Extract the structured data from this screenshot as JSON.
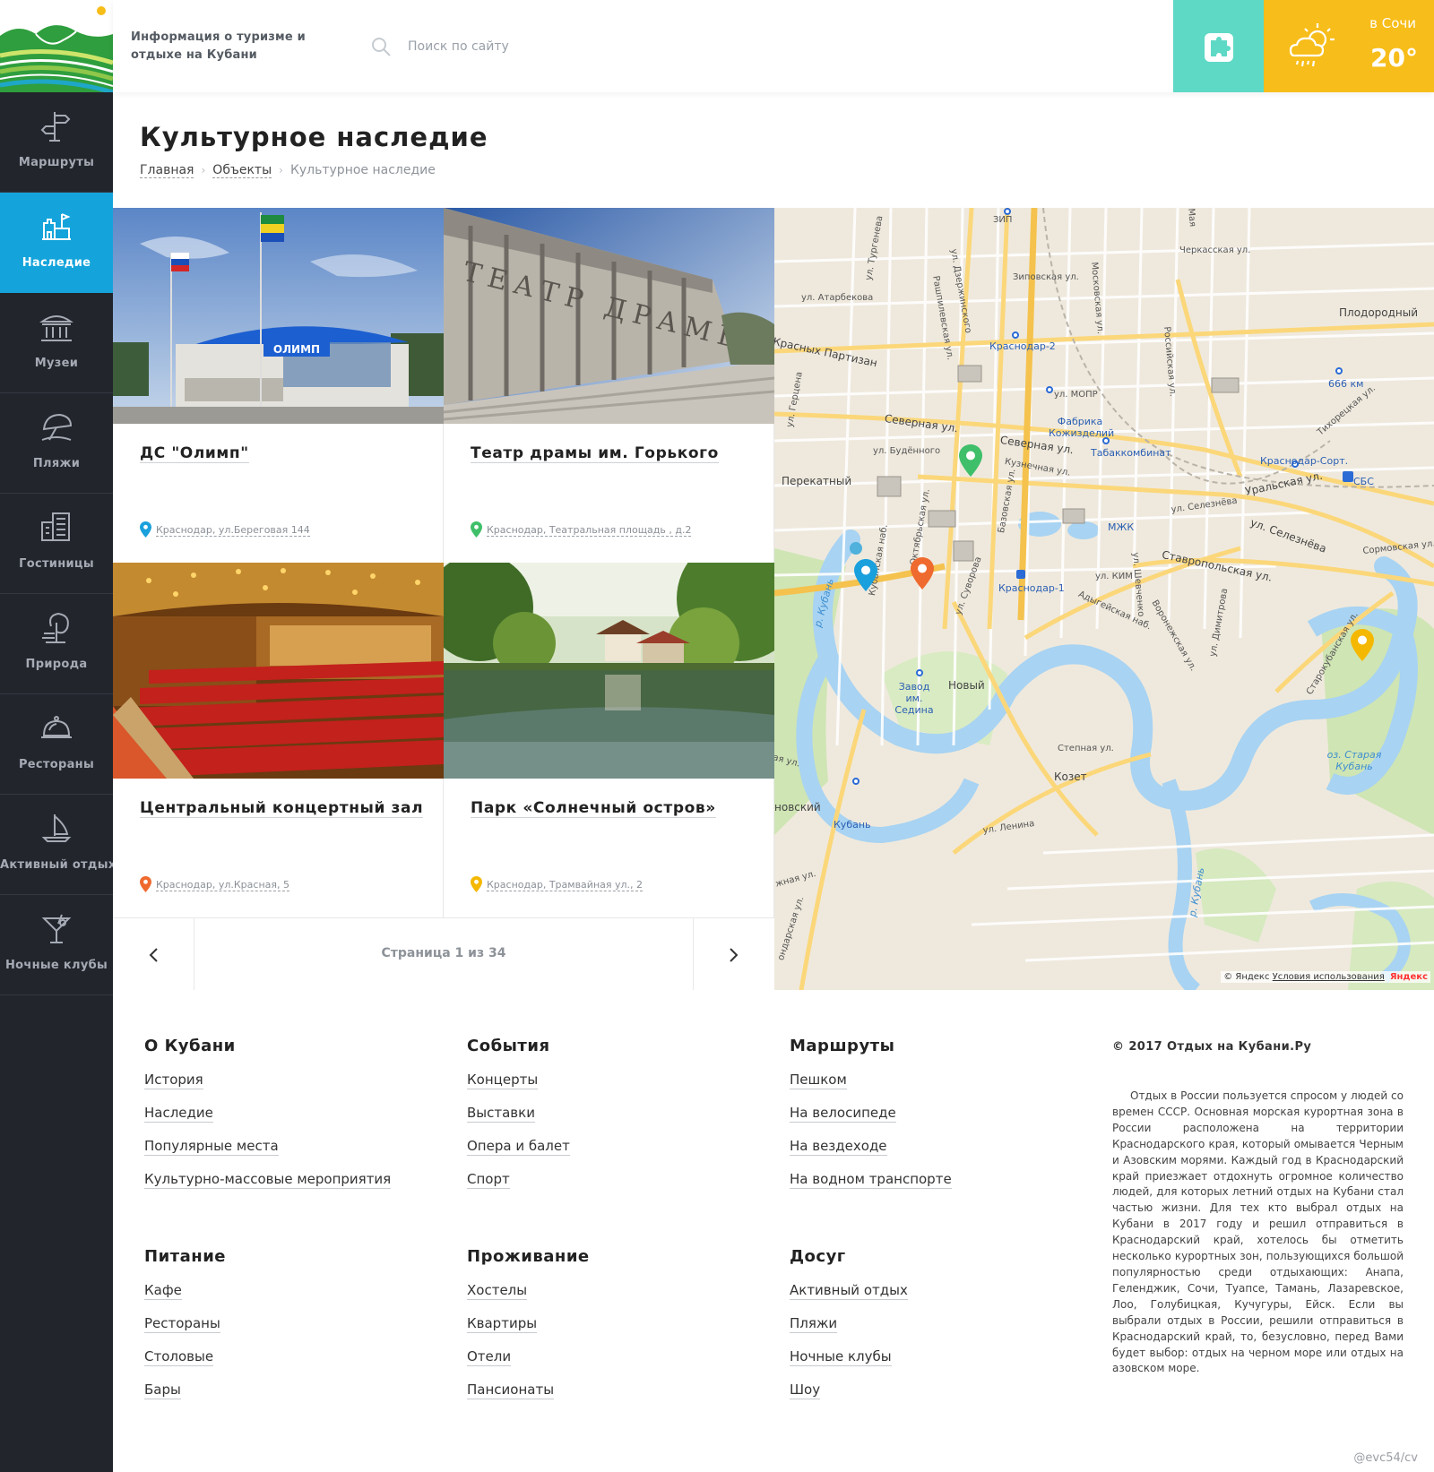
{
  "header": {
    "tagline": "Информация о туризме и отдыхе на Кубани",
    "search_placeholder": "Поиск по сайту",
    "puzzle_icon": "puzzle-icon",
    "weather": {
      "city": "в Сочи",
      "temp": "20°",
      "icon": "cloud-sun-rain-icon"
    }
  },
  "colors": {
    "sidebar_bg": "#22252c",
    "accent_blue": "#14a4db",
    "teal": "#5ed9c6",
    "yellow": "#f7bd1a",
    "pin_blue": "#1aa0dc",
    "pin_green": "#3fbf6a",
    "pin_orange": "#ef6a2e",
    "pin_yellow": "#f5b800"
  },
  "sidebar": {
    "items": [
      {
        "label": "Маршруты",
        "icon": "signpost-icon"
      },
      {
        "label": "Наследие",
        "icon": "castle-icon",
        "active": true
      },
      {
        "label": "Музеи",
        "icon": "museum-icon"
      },
      {
        "label": "Пляжи",
        "icon": "umbrella-icon"
      },
      {
        "label": "Гостиницы",
        "icon": "hotel-icon"
      },
      {
        "label": "Природа",
        "icon": "tree-icon"
      },
      {
        "label": "Рестораны",
        "icon": "cloche-icon"
      },
      {
        "label": "Активный отдых",
        "icon": "sailboat-icon"
      },
      {
        "label": "Ночные клубы",
        "icon": "cocktail-icon"
      }
    ]
  },
  "page": {
    "title": "Культурное наследие",
    "breadcrumb": [
      "Главная",
      "Объекты",
      "Культурное наследие"
    ]
  },
  "cards": [
    {
      "title": "ДС \"Олимп\"",
      "address": "Краснодар, ул.Береговая 144",
      "pin_color": "blue",
      "photo_text": "ОЛИМП"
    },
    {
      "title": "Театр драмы им. Горького",
      "address": "Краснодар, Театральная площадь , д.2",
      "pin_color": "green",
      "photo_text": "ТЕАТР ДРАМЫ"
    },
    {
      "title": "Центральный концертный зал",
      "address": "Краснодар, ул.Красная, 5",
      "pin_color": "orange"
    },
    {
      "title": "Парк «Солнечный остров»",
      "address": "Краснодар, Трамвайная ул., 2",
      "pin_color": "yellow"
    }
  ],
  "pager": {
    "text": "Страница 1 из 34"
  },
  "map": {
    "labels": {
      "zip": "ЗИП",
      "cherkasskaya": "Черкасская ул.",
      "zipovskaya": "Зиповская ул.",
      "atarbekova": "ул. Атарбекова",
      "turgeneva": "ул. Тургенева",
      "dzerzhinskogo": "ул. Дзержинского",
      "rashpilevskaya": "Рашпилевская ул.",
      "moskovskaya": "Московская ул.",
      "maya": "Мая",
      "plodorodny": "Плодородный",
      "krasnodar2": "Краснодар-2",
      "krasnyh_partizan": "Красных Партизан",
      "rossiyskaya": "Российская ул.",
      "km666": "666 км",
      "mopr": "ул. МОПР",
      "fabrika": "Фабрика Кожизделий",
      "severnaya": "Северная ул.",
      "severnaya2": "Северная ул.",
      "budennogo": "ул. Будённого",
      "tabakkombinat": "Табаккомбинат",
      "krasnodar_sort": "Краснодар-Сорт.",
      "sbs": "СБС",
      "uralskaya": "Уральская ул.",
      "perekatny": "Перекатный",
      "kuznechnaya": "Кузнечная ул.",
      "selezneva": "ул. Селезнёва",
      "selezneva2": "ул. Селезнёва",
      "mzhk": "МЖК",
      "sormovskaya": "Сормовская ул.",
      "stavropolskaya": "Ставропольская ул.",
      "tikhoretskaya": "Тихорецкая ул.",
      "kim": "ул. КИМ",
      "krasnodar1": "Краснодар-1",
      "suvorova": "ул. Суворова",
      "kubanskaya_nab": "Кубанская наб.",
      "oktyabrskaya": "Октябрьская ул.",
      "bazovskaya": "Базовская ул.",
      "shevchenko": "ул. Шевченко",
      "adygeyskaya": "Адыгейская наб.",
      "voronezhskaya": "Воронежская ул.",
      "dimitrova": "ул. Димитрова",
      "starokubanskaya": "Старокубанская ул.",
      "gertsena": "ул. Герцена",
      "r_kuban": "р. Кубань",
      "r_kuban2": "р. Кубань",
      "novy": "Новый",
      "zavod": "Завод им. Седина",
      "stepnaya": "Степная ул.",
      "kozet": "Козет",
      "staraya_kuban": "оз. Старая Кубань",
      "novsky": "новский",
      "kuban_st": "Кубань",
      "lenina": "ул. Ленина",
      "krasnodarskaya": "ондарская ул.",
      "zhnaya": "жная ул.",
      "ya_ul": "ая ул."
    },
    "copyright": "© Яндекс",
    "terms": "Условия использования",
    "brand": "Яндекс"
  },
  "footer": {
    "columns": [
      {
        "title": "О Кубани",
        "links": [
          "История",
          "Наследие",
          "Популярные места",
          "Культурно-массовые мероприятия"
        ]
      },
      {
        "title": "События",
        "links": [
          "Концерты",
          "Выставки",
          "Опера и балет",
          "Спорт"
        ]
      },
      {
        "title": "Маршруты",
        "links": [
          "Пешком",
          "На велосипеде",
          "На вездеходе",
          "На водном транспорте"
        ]
      },
      {
        "title": "Питание",
        "links": [
          "Кафе",
          "Рестораны",
          "Столовые",
          "Бары"
        ]
      },
      {
        "title": "Проживание",
        "links": [
          "Хостелы",
          "Квартиры",
          "Отели",
          "Пансионаты"
        ]
      },
      {
        "title": "Досуг",
        "links": [
          "Активный отдых",
          "Пляжи",
          "Ночные клубы",
          "Шоу"
        ]
      }
    ],
    "copyright": "© 2017 Отдых на Кубани.Ру",
    "about": "Отдых в России пользуется спросом у людей со времен СССР. Основная морская курортная зона в России расположена на территории Краснодарского края, который омывается Черным и Азовским морями. Каждый год в Краснодарский край приезжает отдохнуть огромное количество людей, для которых летний отдых на Кубани стал частью жизни. Для тех кто выбрал отдых на Кубани в 2017 году и решил отправиться в Краснодарский край, хотелось бы отметить несколько курортных зон, пользующихся большой популярностью среди отдыхающих: Анапа, Геленджик, Сочи, Туапсе, Тамань, Лазаревское, Лоо, Голубицкая, Кучугуры, Ейск. Если вы выбрали отдых в России, решили отправиться в Краснодарский край, то, безусловно, перед Вами будет выбор: отдых на черном море или отдых на азовском море.",
    "signature": "@evc54/cv"
  }
}
